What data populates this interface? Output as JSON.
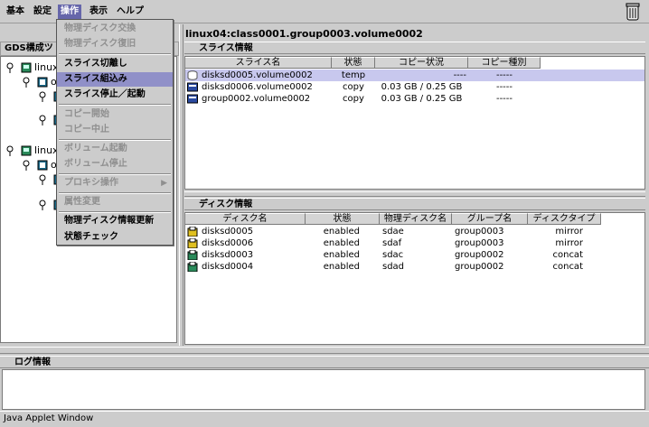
{
  "menubar": {
    "items": [
      "基本",
      "設定",
      "操作",
      "表示",
      "ヘルプ"
    ],
    "active_index": 2
  },
  "left_pane": {
    "title": "GDS構成ツ",
    "tree": [
      "linux",
      "o",
      "linux",
      "o"
    ]
  },
  "dropdown": {
    "items": [
      {
        "label": "物理ディスク交換",
        "enabled": false
      },
      {
        "label": "物理ディスク復旧",
        "enabled": false
      },
      {
        "label": "スライス切離し",
        "enabled": true
      },
      {
        "label": "スライス組込み",
        "enabled": true,
        "highlighted": true
      },
      {
        "label": "スライス停止／起動",
        "enabled": true
      },
      {
        "label": "コピー開始",
        "enabled": false
      },
      {
        "label": "コピー中止",
        "enabled": false
      },
      {
        "label": "ボリューム起動",
        "enabled": false
      },
      {
        "label": "ボリューム停止",
        "enabled": false
      },
      {
        "label": "プロキシ操作",
        "enabled": false,
        "submenu": true
      },
      {
        "label": "属性変更",
        "enabled": false
      },
      {
        "label": "物理ディスク情報更新",
        "enabled": true
      },
      {
        "label": "状態チェック",
        "enabled": true
      }
    ]
  },
  "path_label": "linux04:class0001.group0003.volume0002",
  "slice_panel": {
    "title": "スライス情報",
    "columns": [
      "スライス名",
      "状態",
      "コピー状況",
      "コピー種別"
    ],
    "rows": [
      {
        "name": "disksd0005.volume0002",
        "status": "temp",
        "copy_status": "----",
        "copy_type": "-----"
      },
      {
        "name": "disksd0006.volume0002",
        "status": "copy",
        "copy_status": "0.03 GB / 0.25 GB",
        "copy_type": "-----"
      },
      {
        "name": "group0002.volume0002",
        "status": "copy",
        "copy_status": "0.03 GB / 0.25 GB",
        "copy_type": "-----"
      }
    ]
  },
  "disk_panel": {
    "title": "ディスク情報",
    "columns": [
      "ディスク名",
      "状態",
      "物理ディスク名",
      "グループ名",
      "ディスクタイプ"
    ],
    "rows": [
      {
        "name": "disksd0005",
        "status": "enabled",
        "physical": "sdae",
        "group": "group0003",
        "type": "mirror"
      },
      {
        "name": "disksd0006",
        "status": "enabled",
        "physical": "sdaf",
        "group": "group0003",
        "type": "mirror"
      },
      {
        "name": "disksd0003",
        "status": "enabled",
        "physical": "sdac",
        "group": "group0002",
        "type": "concat"
      },
      {
        "name": "disksd0004",
        "status": "enabled",
        "physical": "sdad",
        "group": "group0002",
        "type": "concat"
      }
    ]
  },
  "log_panel": {
    "title": "ログ情報"
  },
  "status_bar": {
    "text": "Java Applet Window"
  },
  "colors": {
    "background": "#cccccc",
    "menu_active": "#6666aa",
    "menu_highlight": "#9090c8",
    "row_selected": "#c8c8ee"
  }
}
